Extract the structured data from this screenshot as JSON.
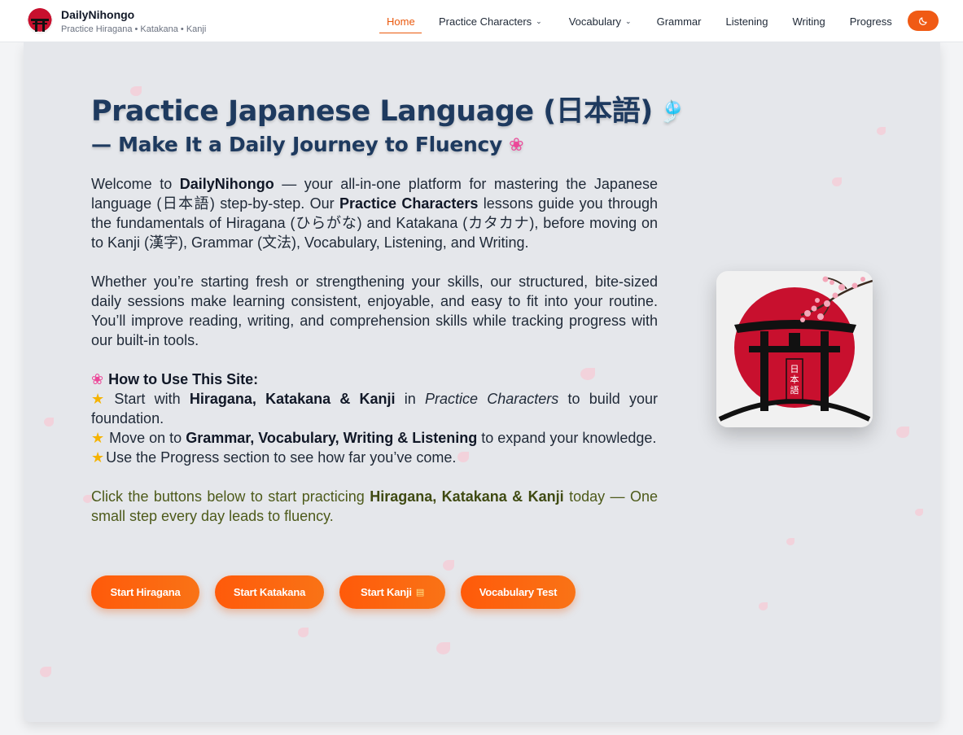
{
  "brand": {
    "name": "DailyNihongo",
    "tagline": "Practice Hiragana • Katakana • Kanji"
  },
  "nav": {
    "items": [
      {
        "label": "Home",
        "active": true,
        "dropdown": false
      },
      {
        "label": "Practice Characters",
        "active": false,
        "dropdown": true
      },
      {
        "label": "Vocabulary",
        "active": false,
        "dropdown": true
      },
      {
        "label": "Grammar",
        "active": false,
        "dropdown": false
      },
      {
        "label": "Listening",
        "active": false,
        "dropdown": false
      },
      {
        "label": "Writing",
        "active": false,
        "dropdown": false
      },
      {
        "label": "Progress",
        "active": false,
        "dropdown": false
      }
    ],
    "theme_toggle_icon": "moon-icon"
  },
  "hero": {
    "title": "Practice Japanese Language (日本語)",
    "subtitle": "— Make It a Daily Journey to Fluency",
    "intro": {
      "p1_a": "Welcome to ",
      "p1_brand": "DailyNihongo",
      "p1_b": " — your all-in-one platform for mastering the Japanese language (日本語) step-by-step. Our ",
      "p1_link": "Practice Characters",
      "p1_c": " lessons guide you through the fundamentals of Hiragana (ひらがな) and Katakana (カタカナ), before moving on to Kanji (漢字), Grammar (文法), Vocabulary, Listening, and Writing.",
      "p2": "Whether you’re starting fresh or strengthening your skills, our structured, bite-sized daily sessions make learning consistent, enjoyable, and easy to fit into your routine. You’ll improve reading, writing, and comprehension skills while tracking progress with our built-in tools."
    },
    "howto": {
      "heading": "How to Use This Site:",
      "step1_a": "Start with ",
      "step1_bold": "Hiragana, Katakana & Kanji",
      "step1_b": " in ",
      "step1_ital": "Practice Characters",
      "step1_c": " to build your foundation.",
      "step2_a": "Move on to ",
      "step2_bold": "Grammar, Vocabulary, Writing & Listening",
      "step2_b": " to expand your knowledge.",
      "step3": "Use the Progress section to see how far you’ve come."
    },
    "cta": {
      "a": "Click the buttons below to start practicing ",
      "bold": "Hiragana, Katakana & Kanji",
      "b": " today — One small step every day leads to fluency."
    },
    "buttons": {
      "hiragana": "Start Hiragana",
      "katakana": "Start Katakana",
      "kanji": "Start Kanji",
      "vocab": "Vocabulary Test"
    },
    "illustration_text": "日本語"
  },
  "colors": {
    "accent": "#ea580c",
    "title": "#1e3a5f",
    "sun_red": "#c8102e"
  }
}
